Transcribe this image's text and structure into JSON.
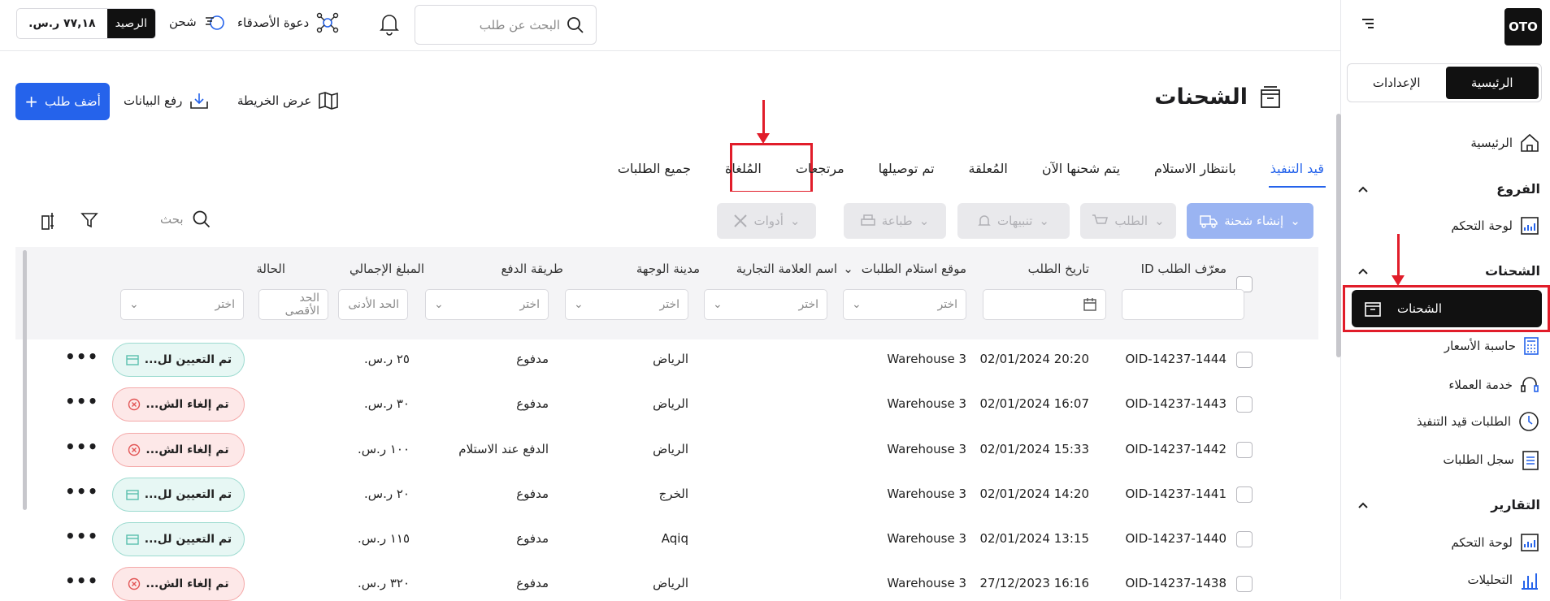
{
  "brand": {
    "logo": "OTO"
  },
  "sidebar": {
    "seg_home": "الرئيسية",
    "seg_settings": "الإعدادات",
    "home": "الرئيسية",
    "group_branches": "الفروع",
    "branches_dashboard": "لوحة التحكم",
    "group_shipments": "الشحنات",
    "shipments_active": "الشحنات",
    "price_calculator": "حاسبة الأسعار",
    "customer_service": "خدمة العملاء",
    "orders_in_progress": "الطلبات قيد التنفيذ",
    "orders_log": "سجل الطلبات",
    "group_reports": "التقارير",
    "reports_dashboard": "لوحة التحكم",
    "analytics": "التحليلات"
  },
  "topbar": {
    "search_placeholder": "البحث عن طلب",
    "invite_friends": "دعوة الأصدقاء",
    "charge": "شحن",
    "balance_label": "الرصيد",
    "balance_amount": "٧٧,١٨ ر.س."
  },
  "page": {
    "title": "الشحنات",
    "map_view": "عرض الخريطة",
    "upload_data": "رفع البيانات",
    "add_order": "أضف طلب"
  },
  "tabs": [
    "قيد التنفيذ",
    "بانتظار الاستلام",
    "يتم شحنها الآن",
    "المُعلقة",
    "تم توصيلها",
    "مرتجعات",
    "المُلغاة",
    "جميع الطلبات"
  ],
  "toolbar": {
    "create_shipment": "إنشاء شحنة",
    "order": "الطلب",
    "alerts": "تنبيهات",
    "print": "طباعة",
    "tools": "أدوات",
    "search": "بحث"
  },
  "columns": {
    "order_id": "معرّف الطلب ID",
    "order_date": "تاريخ الطلب",
    "pickup_location": "موقع استلام الطلبات",
    "brand_name": "اسم العلامة التجارية",
    "destination_city": "مدينة الوجهة",
    "payment_method": "طريقة الدفع",
    "total_amount": "المبلغ الإجمالي",
    "status": "الحالة"
  },
  "filters": {
    "choose": "اختر",
    "min": "الحد الأدنى",
    "max": "الحد الأقصى"
  },
  "rows": [
    {
      "id": "OID-14237-1444",
      "date": "20:20 02/01/2024",
      "location": "Warehouse 3",
      "city": "الرياض",
      "payment": "مدفوع",
      "amount": "٢٥ ر.س.",
      "status": "تم التعيين لل...",
      "status_type": "ok"
    },
    {
      "id": "OID-14237-1443",
      "date": "16:07 02/01/2024",
      "location": "Warehouse 3",
      "city": "الرياض",
      "payment": "مدفوع",
      "amount": "٣٠ ر.س.",
      "status": "تم إلغاء الش...",
      "status_type": "no"
    },
    {
      "id": "OID-14237-1442",
      "date": "15:33 02/01/2024",
      "location": "Warehouse 3",
      "city": "الرياض",
      "payment": "الدفع عند الاستلام",
      "amount": "١٠٠ ر.س.",
      "status": "تم إلغاء الش...",
      "status_type": "no"
    },
    {
      "id": "OID-14237-1441",
      "date": "14:20 02/01/2024",
      "location": "Warehouse 3",
      "city": "الخرج",
      "payment": "مدفوع",
      "amount": "٢٠ ر.س.",
      "status": "تم التعيين لل...",
      "status_type": "ok"
    },
    {
      "id": "OID-14237-1440",
      "date": "13:15 02/01/2024",
      "location": "Warehouse 3",
      "city": "Aqiq",
      "payment": "مدفوع",
      "amount": "١١٥ ر.س.",
      "status": "تم التعيين لل...",
      "status_type": "ok"
    },
    {
      "id": "OID-14237-1438",
      "date": "16:16 27/12/2023",
      "location": "Warehouse 3",
      "city": "الرياض",
      "payment": "مدفوع",
      "amount": "٣٢٠ ر.س.",
      "status": "تم إلغاء الش...",
      "status_type": "no"
    }
  ],
  "colors": {
    "accent": "#2563eb",
    "highlight": "#e11d2a",
    "active": "#111111"
  }
}
